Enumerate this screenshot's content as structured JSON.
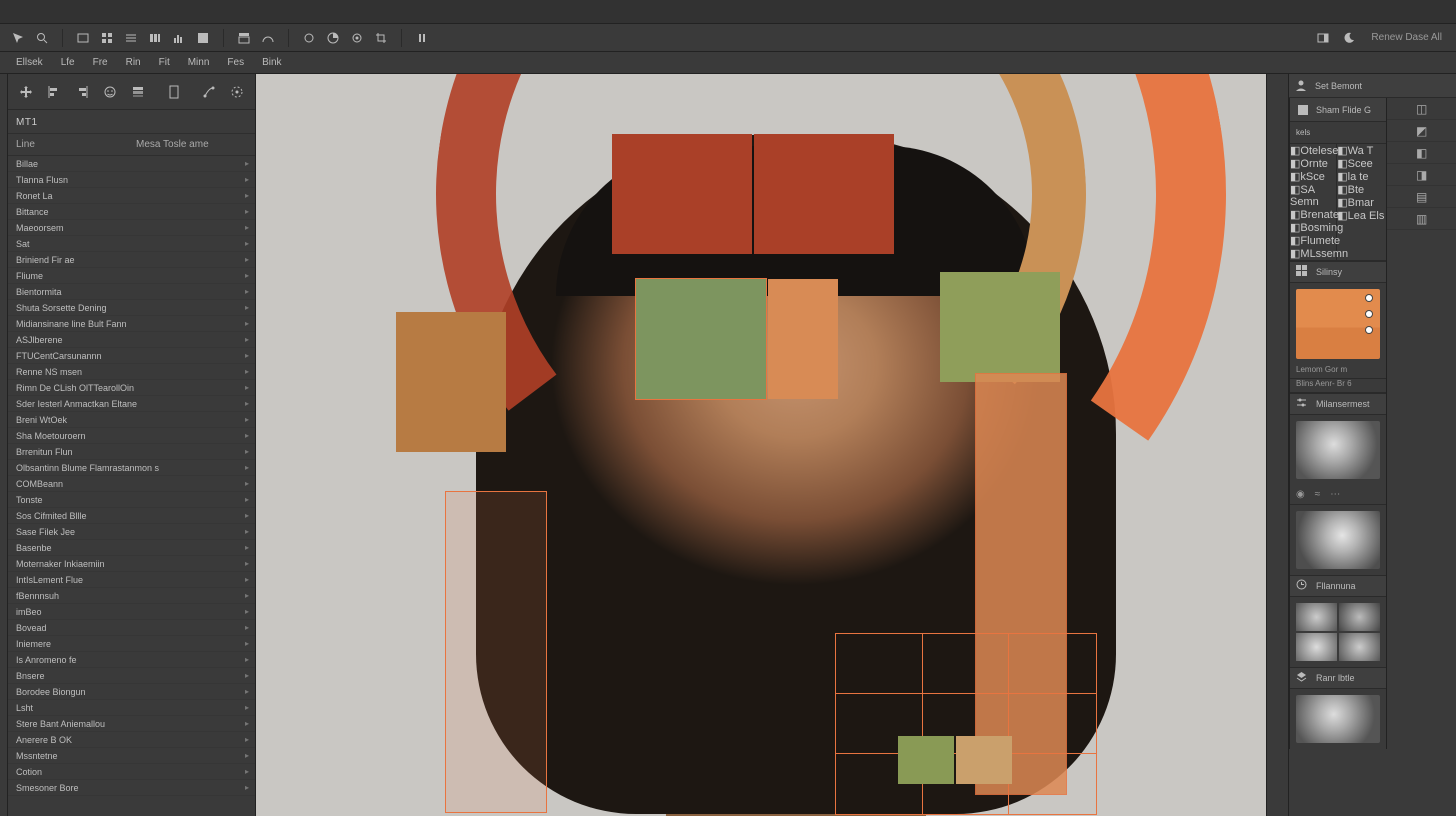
{
  "titlebar": {
    "title": ""
  },
  "toolbar": {
    "left_icons": [
      "cursor-icon",
      "zoom-icon",
      "rect-icon",
      "grid-icon",
      "list-icon",
      "columns-icon",
      "hist-icon",
      "swatch-icon",
      "layout-icon",
      "gauge-icon",
      "circle-icon",
      "pie-icon",
      "target-icon",
      "crop-icon",
      "pause-icon"
    ],
    "right_icons": [
      "panel-icon",
      "moon-icon"
    ],
    "right_label": "Renew Dase All"
  },
  "menubar": {
    "items": [
      "Ellsek",
      "Lfe",
      "Fre",
      "Rin",
      "Fit",
      "Minn",
      "Fes",
      "Bink"
    ]
  },
  "left_toolstrip": {
    "icons": [
      "move-icon",
      "align-left-icon",
      "align-right-icon",
      "smile-icon",
      "stack-icon",
      "doc-icon",
      "paths-icon",
      "orbit-icon"
    ]
  },
  "left_panel": {
    "search_label": "MT1",
    "col_left": "Line",
    "col_right": "Mesa Tosle ame",
    "presets": [
      "Billae",
      "Tlanna Flusn",
      "Ronet La",
      "Bittance",
      "Maeoorsem",
      "Sat",
      "Briniend Fir ae",
      "Fliume",
      "Bientormita",
      "Shuta Sorsette Dening",
      "Midiansinane line Bult Fann",
      "ASJlberene",
      "FTUCentCarsunannn",
      "Renne NS msen",
      "Rimn De CLish OlTTearollOin",
      "Sder Iesterl Anmactkan Eltane",
      "Breni WtOek",
      "Sha Moetouroern",
      "Brrenitun Flun",
      "Olbsantinn Blume Flamrastanmon s",
      "COMBeann",
      "Tonste",
      "Sos Cifmited Bllle",
      "Sase Filek Jee",
      "Basenbe",
      "Moternaker Inkiaemiin",
      "IntIsLement Flue",
      "fBennnsuh",
      "imBeo",
      "Bovead",
      "Iniemere",
      "Is Anromeno fe",
      "Bnsere",
      "Borodee Biongun",
      "Lsht",
      "Stere Bant Aniemallou",
      "Anerere B OK",
      "Mssntetne",
      "Cotion",
      "Smesoner Bore"
    ]
  },
  "right_top": {
    "label": "Set Bemont"
  },
  "right_panel": {
    "head1_label": "Sham Flide G",
    "head1_sub": "kels",
    "swatch_caption": "Lemom Gor m",
    "section_adjust": "Milansermest",
    "section_history": "Fllannuna",
    "section_layers": "Ranr lbtle",
    "caption_under_thumb": "Blins Aenr- Br 6"
  },
  "props_left": {
    "rows": [
      "Otelese",
      "Ornte",
      "kSce",
      "SA Semn",
      "Brenate",
      "Bosming",
      "Flumete",
      "MLssemn"
    ]
  },
  "props_right": {
    "rows": [
      "Wa T",
      "Scee",
      "la te",
      "Bte",
      "Bmar",
      "Lea Els"
    ]
  },
  "colors": {
    "accent": "#e87440",
    "rust": "#aa4028",
    "olive": "#7d955f",
    "tan": "#c99156",
    "panel": "#3a3a3a",
    "canvas_bg": "#c9c7c3"
  }
}
